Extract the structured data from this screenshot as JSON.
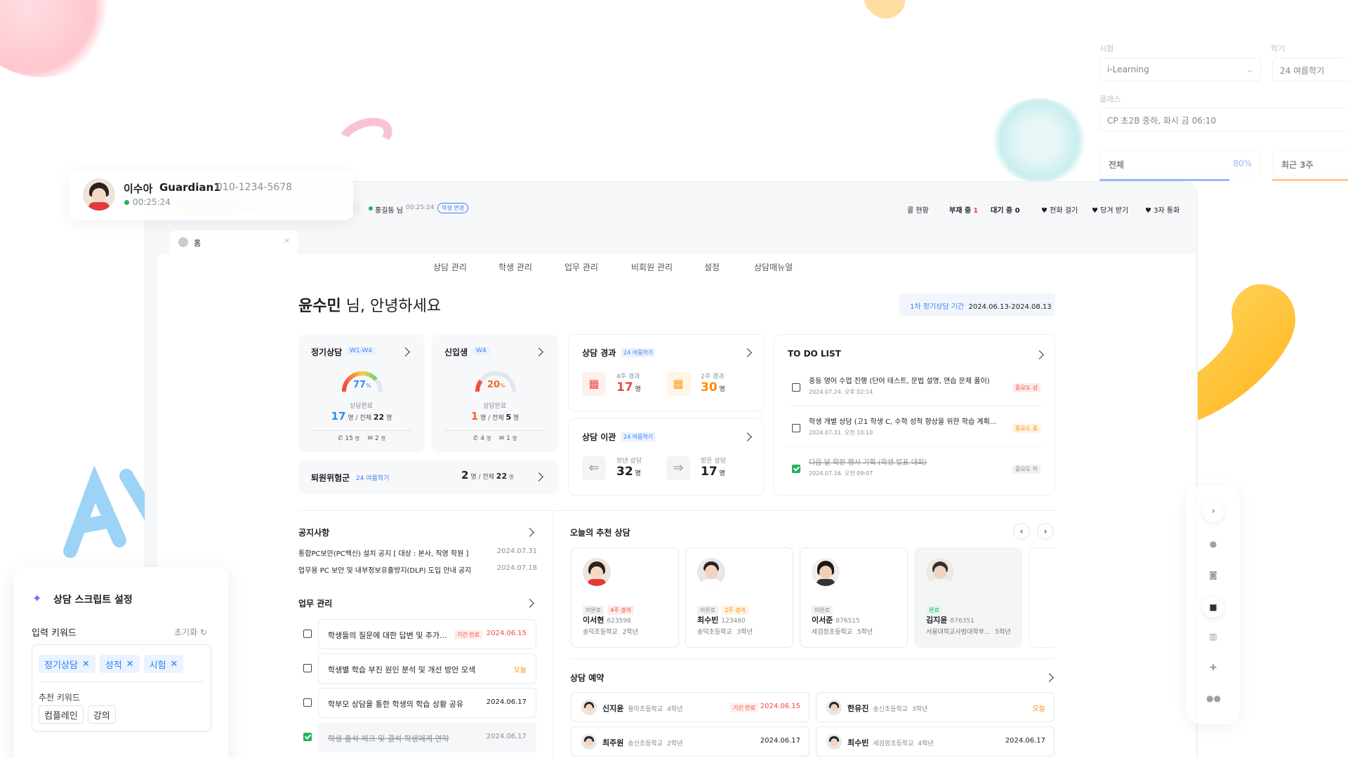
{
  "floating_call": {
    "name": "이수아",
    "role": "Guardian1",
    "phone": "010-1234-5678",
    "timer": "00:25:24"
  },
  "topbar": {
    "agent": "홍길동 님",
    "timer": "00:25:24",
    "status_chip": "학생 변경",
    "items": [
      "콜 현황",
      "부재 중",
      "대기 중 0"
    ],
    "missed_count": "1",
    "actions": [
      "전화 걸기",
      "당겨 받기",
      "3자 통화"
    ]
  },
  "tab": {
    "label": "홈"
  },
  "nav": [
    "상담 관리",
    "학생 관리",
    "업무 관리",
    "비회원 관리",
    "설정",
    "상담매뉴얼"
  ],
  "greeting": {
    "name": "윤수민",
    "suffix": " 님, 안녕하세요"
  },
  "period": {
    "label": "1차 정기상담 기간",
    "range": "2024.06.13-2024.08.13"
  },
  "regular": {
    "title": "정기상담",
    "tag": "W1-W4",
    "percent": "77",
    "percent_unit": "%",
    "caption": "상담완료",
    "done": "17",
    "done_unit": "명 / 전체",
    "total": "22",
    "total_unit": "명",
    "calls": "15",
    "call_unit": "명",
    "msgs": "2",
    "msg_unit": "명",
    "progress": 0.77
  },
  "newcomer": {
    "title": "신입생",
    "tag": "W4",
    "percent": "20",
    "percent_unit": "%",
    "caption": "상담완료",
    "done": "1",
    "done_unit": "명 / 전체",
    "total": "5",
    "total_unit": "명",
    "calls": "4",
    "call_unit": "명",
    "msgs": "1",
    "msg_unit": "명",
    "progress": 0.2
  },
  "withdraw": {
    "title": "퇴원위험군",
    "tag": "24 여름학기",
    "count": "2",
    "unit": "명 / 전체",
    "total": "22",
    "total_unit": "명"
  },
  "elapsed": {
    "title": "상담 경과",
    "tag": "24 여름학기",
    "a_label": "4주 경과",
    "a_value": "17",
    "b_label": "2주 경과",
    "b_value": "30",
    "unit": "명"
  },
  "transfer": {
    "title": "상담 이관",
    "tag": "24 여름학기",
    "a_label": "보낸 상담",
    "a_value": "32",
    "b_label": "받은 상담",
    "b_value": "17",
    "unit": "명"
  },
  "todo": {
    "title": "TO DO LIST",
    "items": [
      {
        "text": "중등 영어 수업 진행 (단어 테스트, 문법 설명, 연습 문제 풀이)",
        "date": "2024.07.24. 오후 02:14",
        "priority": "중요도 상",
        "done": false
      },
      {
        "text": "학생 개별 상담 (고1 학생 C, 수학 성적 향상을 위한 학습 계획...",
        "date": "2024.07.31. 오전 10:10",
        "priority": "중요도 중",
        "done": false
      },
      {
        "text": "다음 달 학원 행사 기획 (학생 발표 대회)",
        "date": "2024.07.16. 오전 09:07",
        "priority": "중요도 하",
        "done": true
      }
    ]
  },
  "notice": {
    "title": "공지사항",
    "items": [
      {
        "text": "통합PC보안(PC백신) 설치 공지 [ 대상 : 본사, 직영 학원 ]",
        "date": "2024.07.31"
      },
      {
        "text": "업무용 PC 보안 및 내부정보유출방지(DLP) 도입 안내 공지",
        "date": "2024.07.18"
      }
    ]
  },
  "work": {
    "title": "업무 관리",
    "items": [
      {
        "text": "학생들의 질문에 대한 답변 및 추가...",
        "badge": "기간 만료",
        "date": "2024.06.15",
        "done": false
      },
      {
        "text": "학생별 학습 부진 원인 분석 및 개선 방안 모색",
        "badge": "",
        "date": "오늘",
        "done": false
      },
      {
        "text": "학부모 상담을 통한 학생의 학습 상황 공유",
        "badge": "",
        "date": "2024.06.17",
        "done": false
      },
      {
        "text": "학생 출석 체크 및 결석 학생에게 연락",
        "badge": "",
        "date": "2024.06.17",
        "done": true
      }
    ]
  },
  "recommend": {
    "title": "오늘의 추천 상담",
    "items": [
      {
        "status": "미완료",
        "extra": "4주 경과",
        "name": "이서현",
        "id": "623598",
        "school": "송덕초등학교",
        "grade": "2학년"
      },
      {
        "status": "미완료",
        "extra": "2주 경과",
        "name": "최수빈",
        "id": "123480",
        "school": "송덕초등학교",
        "grade": "3학년"
      },
      {
        "status": "미완료",
        "extra": "",
        "name": "이서준",
        "id": "876515",
        "school": "세검정초등학교",
        "grade": "5학년"
      },
      {
        "status": "완료",
        "extra": "",
        "name": "김지윤",
        "id": "876351",
        "school": "서울대학교사범대학부...",
        "grade": "5학년"
      }
    ]
  },
  "reservation": {
    "title": "상담 예약",
    "items": [
      {
        "name": "신지윤",
        "school": "용마초등학교",
        "grade": "4학년",
        "badge": "기간 만료",
        "date": "2024.06.15"
      },
      {
        "name": "한유진",
        "school": "송신초등학교",
        "grade": "3학년",
        "badge": "",
        "date": "오늘"
      },
      {
        "name": "최주원",
        "school": "송신초등학교",
        "grade": "2학년",
        "badge": "",
        "date": "2024.06.17"
      },
      {
        "name": "최수빈",
        "school": "세검정초등학교",
        "grade": "4학년",
        "badge": "",
        "date": "2024.06.17"
      }
    ]
  },
  "script_panel": {
    "title": "상담 스크립트 설정",
    "keyword_label": "입력 키워드",
    "reset": "초기화",
    "keywords": [
      "정기상담",
      "성적",
      "시험"
    ],
    "rec_label": "추천 키워드",
    "rec_keywords": [
      "컴플레인",
      "강의"
    ]
  },
  "filter_panel": {
    "label1": "시험",
    "value1": "i-Learning",
    "label2": "학기",
    "value2": "24 여름학기",
    "label3": "클래스",
    "value3": "CP 초2B 중하, 화시 금 06:10",
    "tab1": "전체",
    "tab1_pct": "80%",
    "tab2": "최근 3주"
  },
  "colors": {
    "accent": "#3b82f6",
    "danger": "#f04a3f",
    "warn": "#ff8a00",
    "success": "#22b35e"
  }
}
